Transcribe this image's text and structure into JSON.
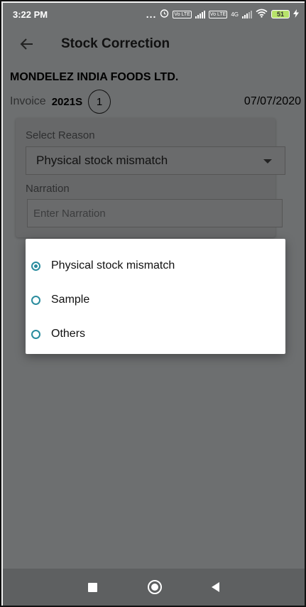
{
  "status_bar": {
    "time": "3:22 PM",
    "dots": "...",
    "volte_1": "Vo LTE",
    "volte_2": "Vo LTE",
    "network": "4G",
    "battery": "51"
  },
  "app_bar": {
    "title": "Stock Correction",
    "back_icon": "arrow-left-icon"
  },
  "header": {
    "company": "MONDELEZ INDIA FOODS LTD.",
    "invoice_label": "Invoice",
    "invoice_number": "2021S",
    "invoice_count": "1",
    "date": "07/07/2020"
  },
  "form": {
    "reason_label": "Select Reason",
    "reason_value": "Physical stock mismatch",
    "narration_label": "Narration",
    "narration_placeholder": "Enter Narration",
    "narration_value": ""
  },
  "dialog": {
    "options": [
      {
        "label": "Physical stock mismatch",
        "selected": true
      },
      {
        "label": "Sample",
        "selected": false
      },
      {
        "label": "Others",
        "selected": false
      }
    ]
  },
  "nav_bar": {
    "icons": [
      "recents-square-icon",
      "home-circle-icon",
      "back-triangle-icon"
    ]
  },
  "colors": {
    "accent": "#2a8c9e",
    "scrim": "#6d6f70"
  }
}
